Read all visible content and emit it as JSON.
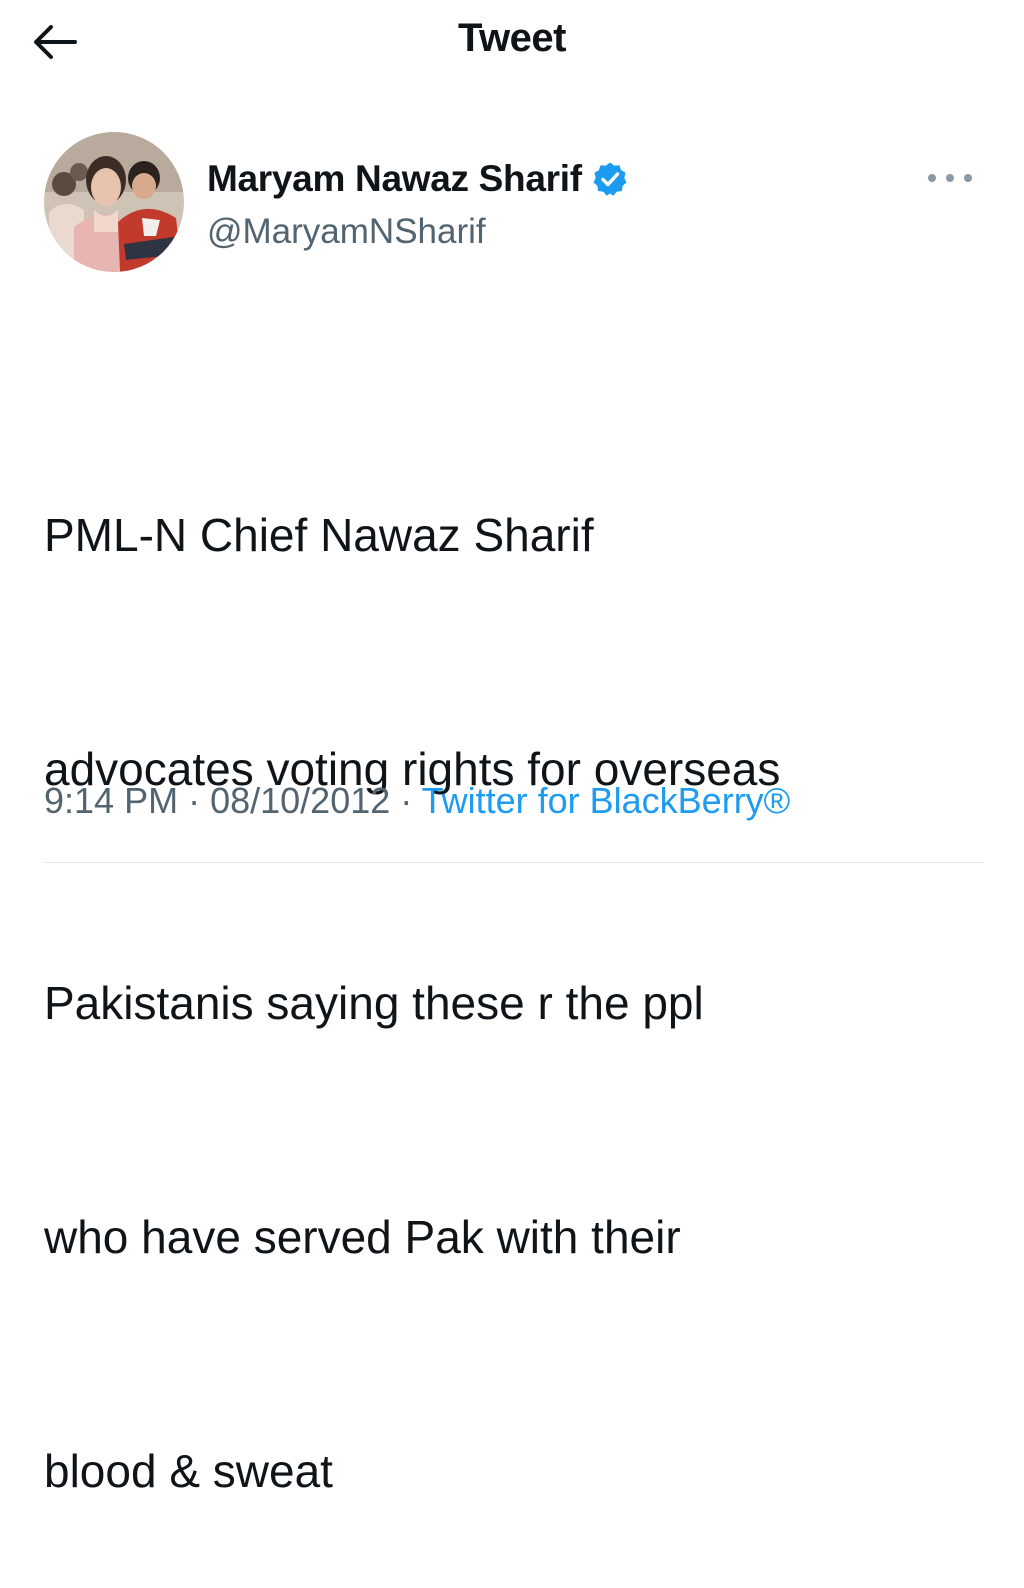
{
  "header": {
    "title": "Tweet",
    "back_icon": "arrow-left-icon"
  },
  "author": {
    "display_name": "Maryam Nawaz Sharif",
    "handle": "@MaryamNSharif",
    "verified_icon": "verified-badge-icon",
    "more_icon": "more-horizontal-icon"
  },
  "tweet": {
    "lines": [
      "PML-N Chief Nawaz Sharif",
      "advocates voting rights for overseas",
      "Pakistanis saying these r the ppl",
      "who have served Pak with their",
      "blood & sweat"
    ]
  },
  "meta": {
    "time": "9:14 PM",
    "separator": " · ",
    "date": "08/10/2012",
    "source": "Twitter for BlackBerry®"
  },
  "colors": {
    "text": "#0f1419",
    "secondary": "#536471",
    "link": "#1d9bf0",
    "verified": "#1d9bf0"
  }
}
